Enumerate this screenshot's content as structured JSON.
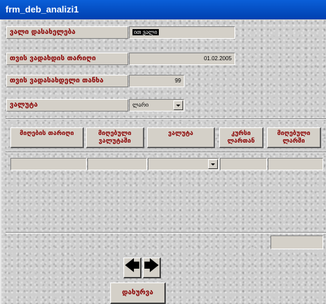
{
  "window": {
    "title": "frm_deb_analizi1"
  },
  "form": {
    "client_label": "ვალი დასახელება",
    "client_value": "ით ვალი",
    "date_label": "თვის ვადახდის თარიღი",
    "date_value": "01.02.2005",
    "amount_label": "თვის ვადასახდელი თანხა",
    "amount_value": "99",
    "currency_label": "ვალუტა",
    "currency_value": "ლარი"
  },
  "table": {
    "headers": [
      "მიღების თარიღი",
      "მიღებული ვალუტაში",
      "ვალუტა",
      "კურსი ლართან",
      "მიღებული ლარში"
    ]
  },
  "buttons": {
    "prev_glyph": "🡄",
    "next_glyph": "🡆",
    "close_label": "დახურვა"
  }
}
